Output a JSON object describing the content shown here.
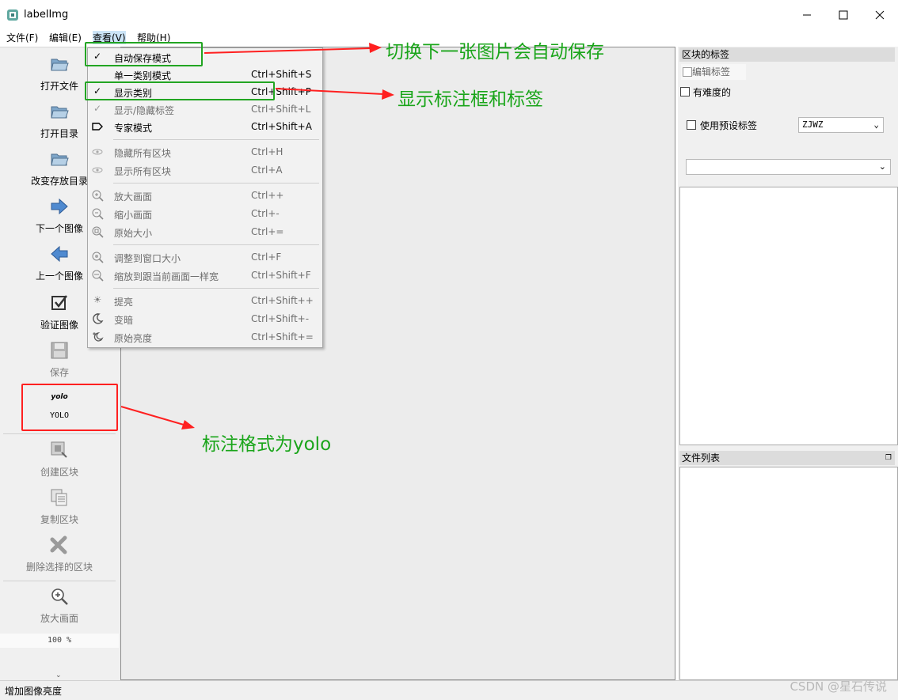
{
  "window": {
    "title": "labelImg",
    "controls": [
      "minimize-icon",
      "maximize-icon",
      "close-icon"
    ]
  },
  "menubar": [
    "文件(F)",
    "编辑(E)",
    "查看(V)",
    "帮助(H)"
  ],
  "toolbar": {
    "items": [
      {
        "label": "打开文件",
        "icon": "folder-open-icon",
        "enabled": true
      },
      {
        "label": "打开目录",
        "icon": "folder-open-icon",
        "enabled": true
      },
      {
        "label": "改变存放目录",
        "icon": "folder-open-icon",
        "enabled": true
      },
      {
        "label": "下一个图像",
        "icon": "arrow-right-icon",
        "enabled": true
      },
      {
        "label": "上一个图像",
        "icon": "arrow-left-icon",
        "enabled": true
      },
      {
        "label": "验证图像",
        "icon": "checkbox-icon",
        "enabled": true
      },
      {
        "label": "保存",
        "icon": "save-icon",
        "enabled": false
      },
      {
        "label": "YOLO",
        "icon_text": "yolo",
        "enabled": true
      },
      {
        "label": "创建区块",
        "icon": "create-box-icon",
        "enabled": false
      },
      {
        "label": "复制区块",
        "icon": "copy-icon",
        "enabled": false
      },
      {
        "label": "删除选择的区块",
        "icon": "delete-icon",
        "enabled": false
      },
      {
        "label": "放大画面",
        "icon": "zoom-in-icon",
        "enabled": false
      }
    ],
    "zoom_value": "100 %"
  },
  "view_menu": {
    "items": [
      {
        "label": "自动保存模式",
        "shortcut": "",
        "checked": true,
        "icon": "check-icon",
        "enabled": true
      },
      {
        "label": "单一类别模式",
        "shortcut": "Ctrl+Shift+S",
        "checked": false,
        "enabled": true
      },
      {
        "label": "显示类别",
        "shortcut": "Ctrl+Shift+P",
        "checked": true,
        "icon": "check-icon",
        "enabled": true
      },
      {
        "label": "显示/隐藏标签",
        "shortcut": "Ctrl+Shift+L",
        "checked": true,
        "icon": "check-icon",
        "enabled": false
      },
      {
        "label": "专家模式",
        "shortcut": "Ctrl+Shift+A",
        "icon": "expert-icon",
        "enabled": true
      },
      {
        "label": "隐藏所有区块",
        "shortcut": "Ctrl+H",
        "icon": "eye-icon",
        "enabled": false
      },
      {
        "label": "显示所有区块",
        "shortcut": "Ctrl+A",
        "icon": "eye-icon",
        "enabled": false
      },
      {
        "label": "放大画面",
        "shortcut": "Ctrl++",
        "icon": "zoom-in-icon",
        "enabled": false
      },
      {
        "label": "缩小画面",
        "shortcut": "Ctrl+-",
        "icon": "zoom-out-icon",
        "enabled": false
      },
      {
        "label": "原始大小",
        "shortcut": "Ctrl+=",
        "icon": "zoom-reset-icon",
        "enabled": false
      },
      {
        "label": "调整到窗口大小",
        "shortcut": "Ctrl+F",
        "icon": "fit-window-icon",
        "enabled": false
      },
      {
        "label": "缩放到跟当前画面一样宽",
        "shortcut": "Ctrl+Shift+F",
        "icon": "fit-width-icon",
        "enabled": false
      },
      {
        "label": "提亮",
        "shortcut": "Ctrl+Shift++",
        "icon": "sun-icon",
        "enabled": false
      },
      {
        "label": "变暗",
        "shortcut": "Ctrl+Shift+-",
        "icon": "moon-icon",
        "enabled": false
      },
      {
        "label": "原始亮度",
        "shortcut": "Ctrl+Shift+=",
        "icon": "brightness-reset-icon",
        "enabled": false
      }
    ]
  },
  "right_panel": {
    "box_labels_title": "区块的标签",
    "edit_label_button": "编辑标签",
    "difficult_checkbox": "有难度的",
    "use_default_label_checkbox": "使用预设标签",
    "default_label_value": "ZJWZ",
    "label_filter_value": "",
    "file_list_title": "文件列表"
  },
  "statusbar": {
    "text": "增加图像亮度"
  },
  "annotations": {
    "autosave_note": "切换下一张图片会自动保存",
    "show_label_note": "显示标注框和标签",
    "yolo_note": "标注格式为yolo"
  },
  "watermark": "CSDN @星石传说",
  "colors": {
    "highlight_green": "#22a522",
    "arrow_red": "#ff2020",
    "annotation_text": "#1aa51a"
  }
}
